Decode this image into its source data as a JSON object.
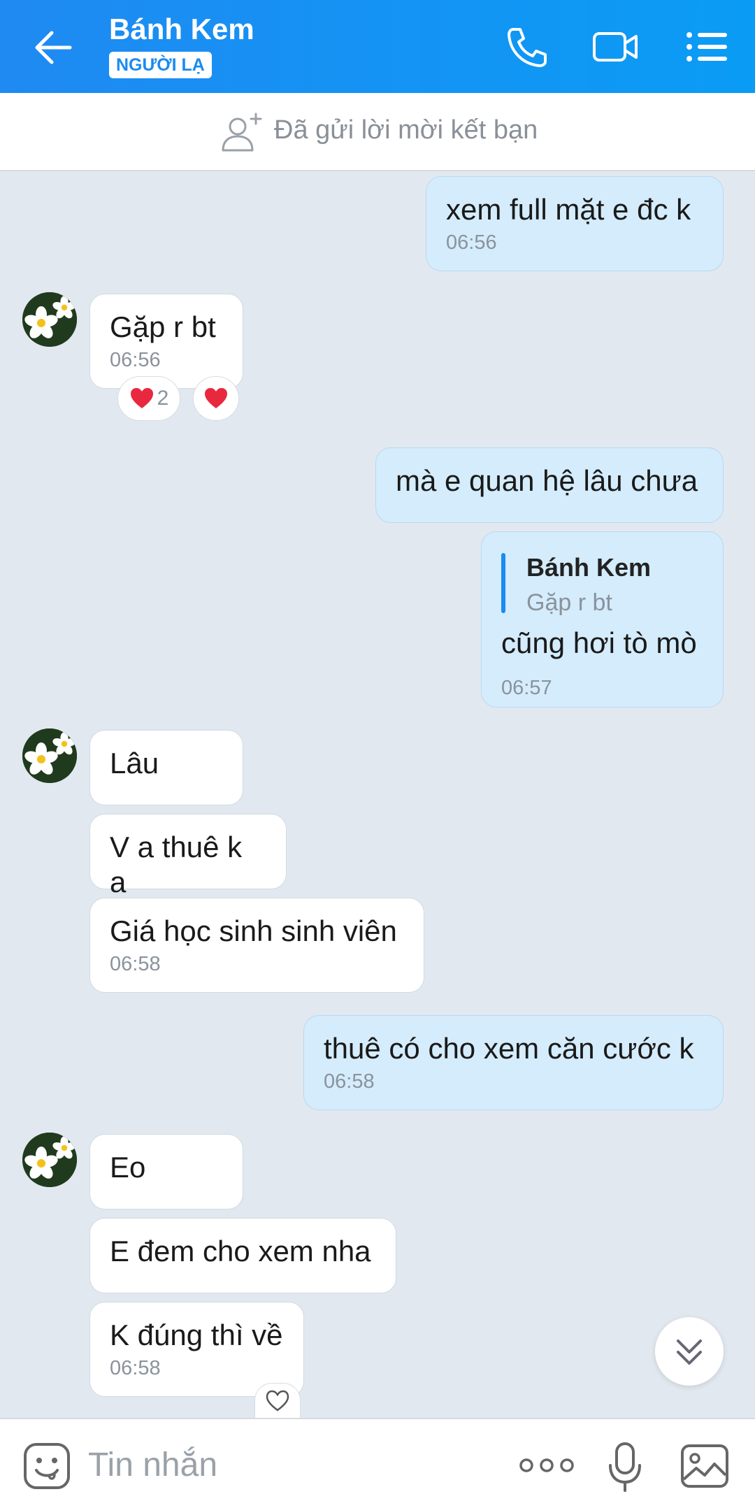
{
  "header": {
    "title": "Bánh Kem",
    "badge": "NGƯỜI LẠ",
    "icons": [
      "back-arrow-icon",
      "phone-icon",
      "video-camera-icon",
      "list-menu-icon"
    ]
  },
  "friend_request": {
    "text": "Đã gửi lời mời kết bạn",
    "icon": "add-friend-icon"
  },
  "messages": [
    {
      "direction": "out",
      "text": "xem full mặt e đc k",
      "time": "06:56"
    },
    {
      "direction": "in",
      "text": "Gặp r bt",
      "time": "06:56",
      "reaction_count": "2"
    },
    {
      "direction": "out",
      "text": "mà e quan hệ lâu chưa"
    },
    {
      "direction": "out",
      "quote_name": "Bánh Kem",
      "quote_text": "Gặp r bt",
      "text": "cũng hơi tò mò",
      "time": "06:57"
    },
    {
      "direction": "in",
      "text": "Lâu"
    },
    {
      "direction": "in",
      "text": "V a thuê k a"
    },
    {
      "direction": "in",
      "text": "Giá học sinh sinh viên",
      "time": "06:58"
    },
    {
      "direction": "out",
      "text": "thuê có cho xem căn cước k",
      "time": "06:58"
    },
    {
      "direction": "in",
      "text": "Eo"
    },
    {
      "direction": "in",
      "text": "E đem cho xem nha"
    },
    {
      "direction": "in",
      "text": "K đúng thì về",
      "time": "06:58"
    }
  ],
  "composer": {
    "placeholder": "Tin nhắn"
  },
  "colors": {
    "header_start": "#1f8af2",
    "header_end": "#0a9cf5",
    "background": "#e2e8ef",
    "outgoing_bubble": "#d4ecfc",
    "incoming_bubble": "#ffffff",
    "reaction_heart": "#e8283f"
  }
}
